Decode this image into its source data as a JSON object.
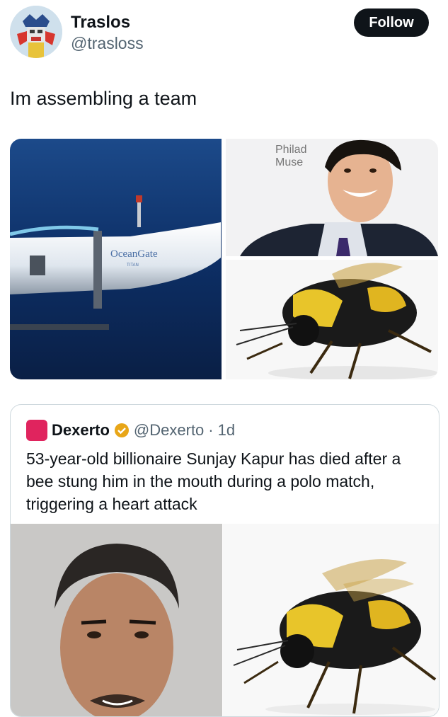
{
  "user": {
    "display_name": "Traslos",
    "handle": "@trasloss",
    "follow_label": "Follow"
  },
  "tweet": {
    "text": "Im assembling a team"
  },
  "media": {
    "sub_brand": "OceanGate",
    "sub_model": "TITAN",
    "sign_line1": "Philad",
    "sign_line2": "Muse"
  },
  "quote": {
    "name": "Dexerto",
    "handle": "@Dexerto",
    "separator": "·",
    "age": "1d",
    "text": "53-year-old billionaire Sunjay Kapur has died after a bee stung him in the mouth during a polo match, triggering a heart attack"
  },
  "colors": {
    "follow_bg": "#0f1419",
    "verified": "#e8a618",
    "dexerto_logo": "#e0245e",
    "handle_gray": "#536471"
  }
}
